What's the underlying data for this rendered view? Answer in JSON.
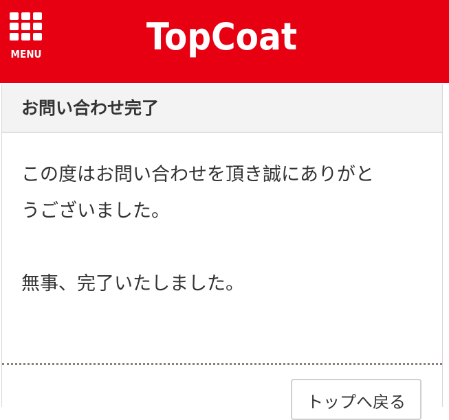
{
  "header": {
    "menu_label": "MENU",
    "menu_icon": "grid-menu-icon",
    "logo_text": "TopCoat",
    "background_color": "#e60012"
  },
  "panel": {
    "title": "お問い合わせ完了",
    "message_lines": [
      "この度はお問い合わせを頂き誠にありがと",
      "うございました。",
      "無事、完了いたしました。"
    ],
    "back_button_label": "トップへ戻る"
  }
}
